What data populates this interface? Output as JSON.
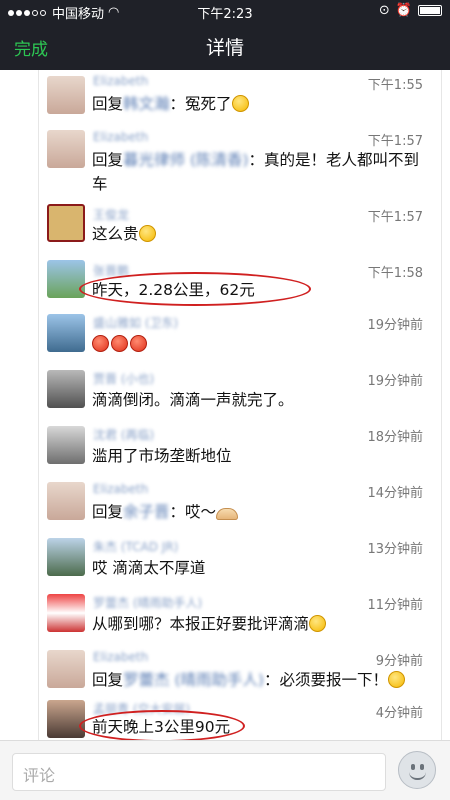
{
  "status_bar": {
    "carrier": "中国移动",
    "time": "下午2:23"
  },
  "nav": {
    "done": "完成",
    "title": "详情"
  },
  "comments": [
    {
      "name": "Elizabeth",
      "time": "下午1:55",
      "reply_prefix": "回复",
      "reply_to": "韩文瀚",
      "text": "：冤死了",
      "emoji": "yellow"
    },
    {
      "name": "Elizabeth",
      "time": "下午1:57",
      "reply_prefix": "回复",
      "reply_to": "暮光律师 (陈清香)",
      "text": "：真的是！老人都叫不到车"
    },
    {
      "name": "王俊龙",
      "time": "下午1:57",
      "text": "这么贵",
      "emoji": "yellow"
    },
    {
      "name": "张晋鹏",
      "time": "下午1:58",
      "text": "昨天，2.28公里，62元"
    },
    {
      "name": "盛山雅如 (卫东)",
      "time": "19分钟前",
      "text": "",
      "emojis": [
        "red",
        "red",
        "red"
      ]
    },
    {
      "name": "贾晋 (小也)",
      "time": "19分钟前",
      "text": "滴滴倒闭。滴滴一声就完了。"
    },
    {
      "name": "沈君 (再临)",
      "time": "18分钟前",
      "text": "滥用了市场垄断地位"
    },
    {
      "name": "Elizabeth",
      "time": "14分钟前",
      "reply_prefix": "回复",
      "reply_to": "余子晋",
      "text": "：哎～",
      "emoji": "fan"
    },
    {
      "name": "朱杰 (TCAD JR)",
      "time": "13分钟前",
      "text": "哎 滴滴太不厚道"
    },
    {
      "name": "罗蕾杰 (晴雨助手人)",
      "time": "11分钟前",
      "text": "从哪到哪？本报正好要批评滴滴",
      "emoji": "yellow"
    },
    {
      "name": "Elizabeth",
      "time": "9分钟前",
      "reply_prefix": "回复",
      "reply_to": "罗蕾杰 (晴雨助手人)",
      "text": "：必须要报一下！",
      "emoji": "yellow"
    },
    {
      "name": "孟丽青 (交大安居)",
      "time": "4分钟前",
      "text": "前天晚上3公里90元"
    }
  ],
  "input": {
    "placeholder": "评论"
  },
  "colors": {
    "nav_bg": "#1f2128",
    "done_green": "#2dc653",
    "name_blue": "#8aa2c8",
    "highlight_red": "#d02020"
  }
}
